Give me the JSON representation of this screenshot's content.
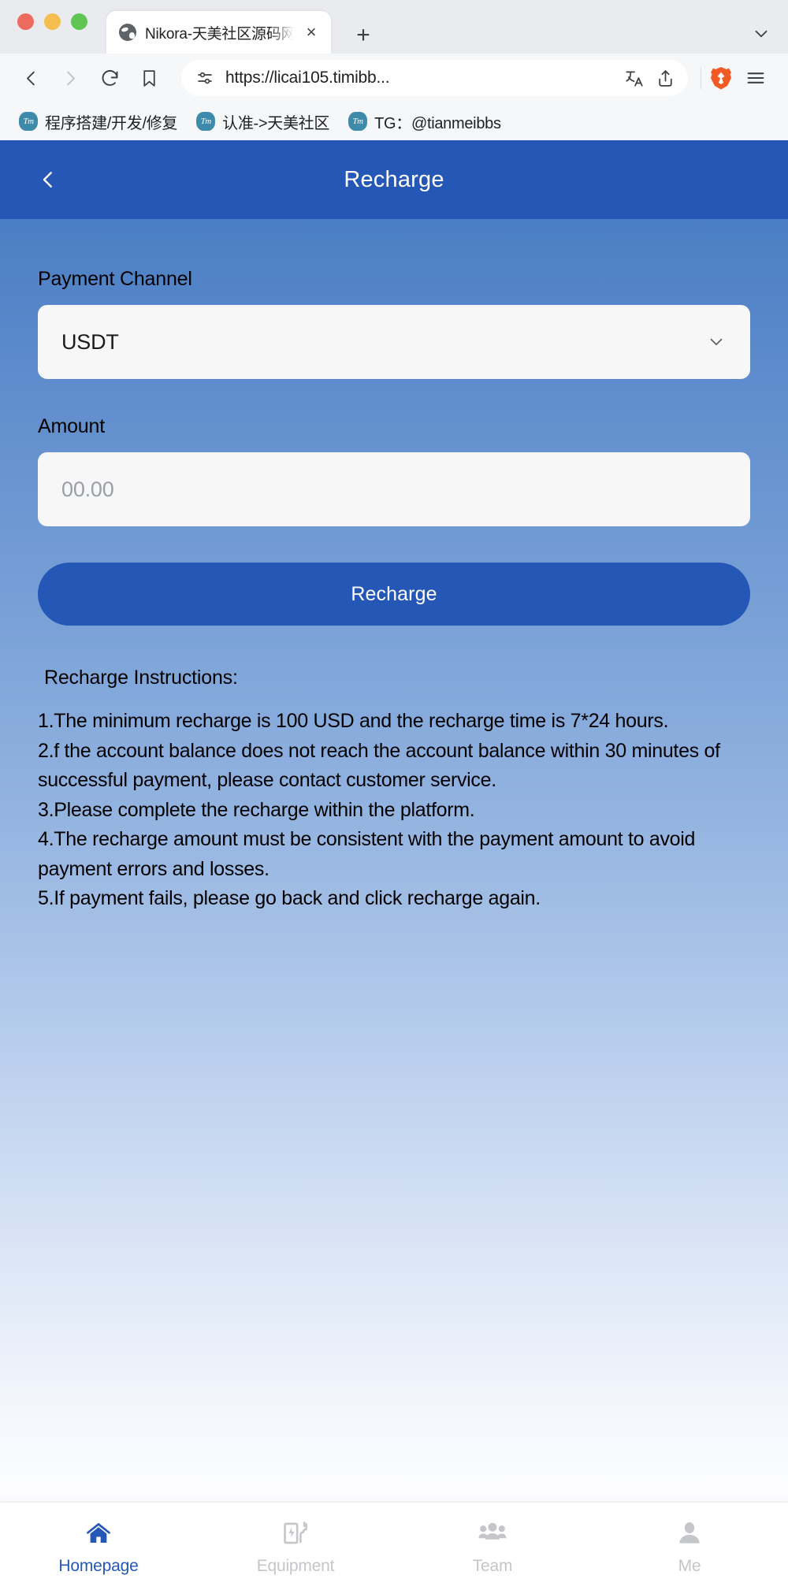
{
  "browser": {
    "tab": {
      "title": "Nikora-天美社区源码网timibbs",
      "favicon": "globe-icon",
      "close_label": "×"
    },
    "new_tab_label": "+",
    "tab_list_chevron": "chevron-down-icon",
    "toolbar": {
      "back": "back-arrow-icon",
      "forward": "forward-arrow-icon",
      "reload": "reload-icon",
      "bookmark": "bookmark-icon",
      "site_settings": "sliders-icon",
      "url": "https://licai105.timibb...",
      "translate": "translate-icon",
      "share": "share-icon",
      "brave_shields": "brave-lion-icon",
      "menu": "hamburger-menu-icon"
    },
    "bookmarks": [
      {
        "icon_text": "Tm",
        "label": "程序搭建/开发/修复"
      },
      {
        "icon_text": "Tm",
        "label": "认准->天美社区"
      },
      {
        "icon_text": "Tm",
        "label": "TG：@tianmeibbs"
      }
    ]
  },
  "app": {
    "header": {
      "back_icon": "chevron-left-icon",
      "title": "Recharge"
    },
    "form": {
      "channel_label": "Payment Channel",
      "channel_value": "USDT",
      "channel_chevron": "chevron-down-icon",
      "amount_label": "Amount",
      "amount_value": "",
      "amount_placeholder": "00.00",
      "submit_label": "Recharge"
    },
    "instructions": {
      "title": "Recharge Instructions:",
      "items": [
        "1.The minimum recharge is 100 USD and the recharge time is 7*24 hours.",
        "2.f the account balance does not reach the account balance within 30 minutes of successful payment, please contact customer service.",
        "3.Please complete the recharge within the platform.",
        "4.The recharge amount must be consistent with the payment amount to avoid payment errors and losses.",
        "5.If payment fails, please go back and click recharge again."
      ]
    },
    "tabbar": [
      {
        "label": "Homepage",
        "icon": "home-icon",
        "active": true
      },
      {
        "label": "Equipment",
        "icon": "ev-charger-icon",
        "active": false
      },
      {
        "label": "Team",
        "icon": "people-icon",
        "active": false
      },
      {
        "label": "Me",
        "icon": "person-icon",
        "active": false
      }
    ]
  },
  "colors": {
    "brand_blue": "#2557b7",
    "active_tab_blue": "#2557b7",
    "inactive_gray": "#c4c6c9",
    "field_bg": "#f7f7f7"
  }
}
